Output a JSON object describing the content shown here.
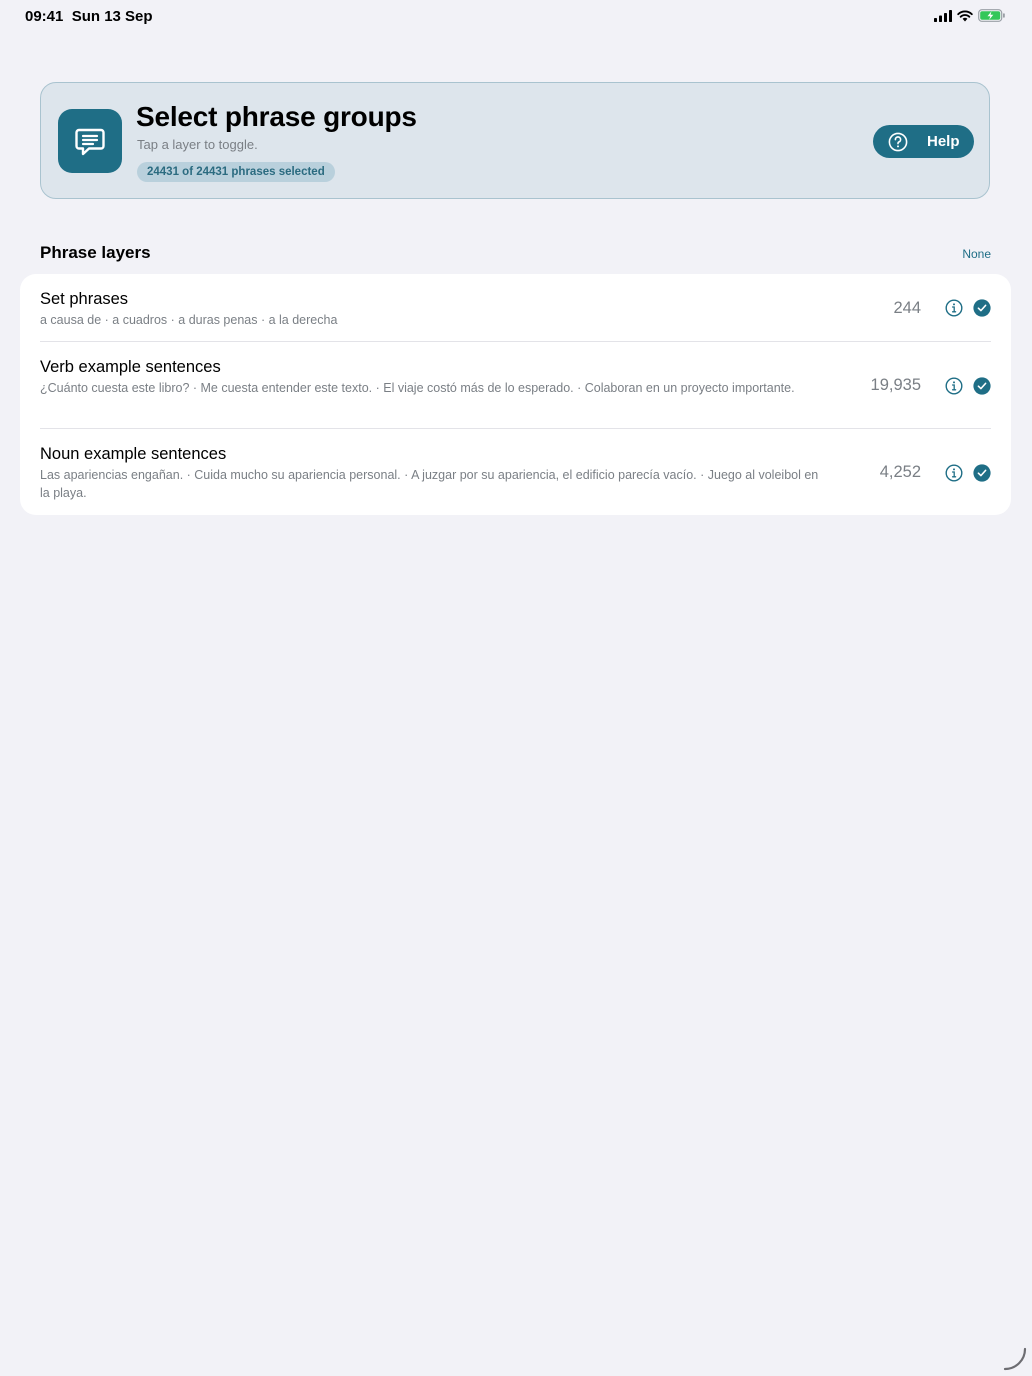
{
  "status_bar": {
    "time_date": "09:41  Sun 13 Sep"
  },
  "header": {
    "title": "Select phrase groups",
    "subtitle": "Tap a layer to toggle.",
    "badge": "24431 of 24431 phrases selected",
    "help_label": "Help",
    "accent_color": "#1f6e86"
  },
  "section": {
    "title": "Phrase layers",
    "none_label": "None"
  },
  "layers": [
    {
      "title": "Set phrases",
      "examples": "a causa de · a cuadros · a duras penas · a la derecha",
      "count": "244",
      "selected": true
    },
    {
      "title": "Verb example sentences",
      "examples": "¿Cuánto cuesta este libro? · Me cuesta entender este texto. · El viaje costó más de lo esperado. · Colaboran en un proyecto importante.",
      "count": "19,935",
      "selected": true
    },
    {
      "title": "Noun example sentences",
      "examples": "Las apariencias engañan. · Cuida mucho su apariencia personal. · A juzgar por su apariencia, el edificio parecía vacío. · Juego al voleibol en la playa.",
      "count": "4,252",
      "selected": true
    }
  ]
}
